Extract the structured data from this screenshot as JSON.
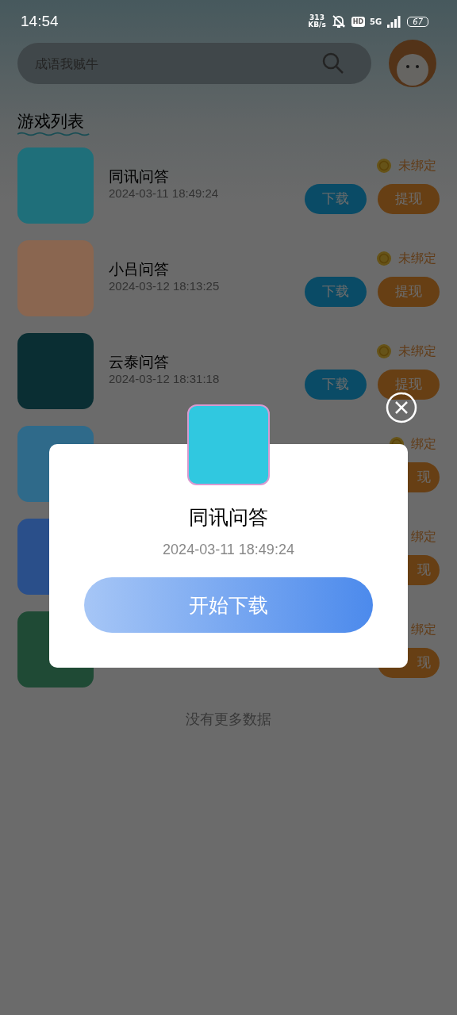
{
  "status_bar": {
    "time": "14:54",
    "speed_value": "313",
    "speed_unit": "KB/s",
    "hd": "HD",
    "network": "5G",
    "battery": "67"
  },
  "search": {
    "placeholder": "成语我贼牛"
  },
  "section_title": "游戏列表",
  "games": [
    {
      "name": "同讯问答",
      "time": "2024-03-11 18:49:24",
      "color": "#1f6f7a",
      "badge": "未绑定",
      "download": {
        "label": "下载"
      },
      "withdraw": {
        "label": "提现"
      }
    },
    {
      "name": "小吕问答",
      "time": "2024-03-12 18:13:25",
      "color": "#8a6650",
      "badge": "未绑定",
      "download": {
        "label": "下载"
      },
      "withdraw": {
        "label": "提现"
      }
    },
    {
      "name": "云泰问答",
      "time": "2024-03-12 18:31:18",
      "color": "#0a2e33",
      "badge": "未绑定",
      "download": {
        "label": "下载"
      },
      "withdraw": {
        "label": "提现"
      }
    },
    {
      "color": "#2f6a8a",
      "badge": "绑定",
      "withdraw": {
        "label": "现"
      }
    },
    {
      "color": "#2a4f8a",
      "badge": "绑定",
      "withdraw": {
        "label": "现"
      }
    },
    {
      "color": "#1f4a35",
      "badge": "绑定",
      "withdraw": {
        "label": "现"
      }
    }
  ],
  "footer": "没有更多数据",
  "dialog": {
    "color": "#30c8e0",
    "title": "同讯问答",
    "time": "2024-03-11 18:49:24",
    "button": "开始下载"
  }
}
